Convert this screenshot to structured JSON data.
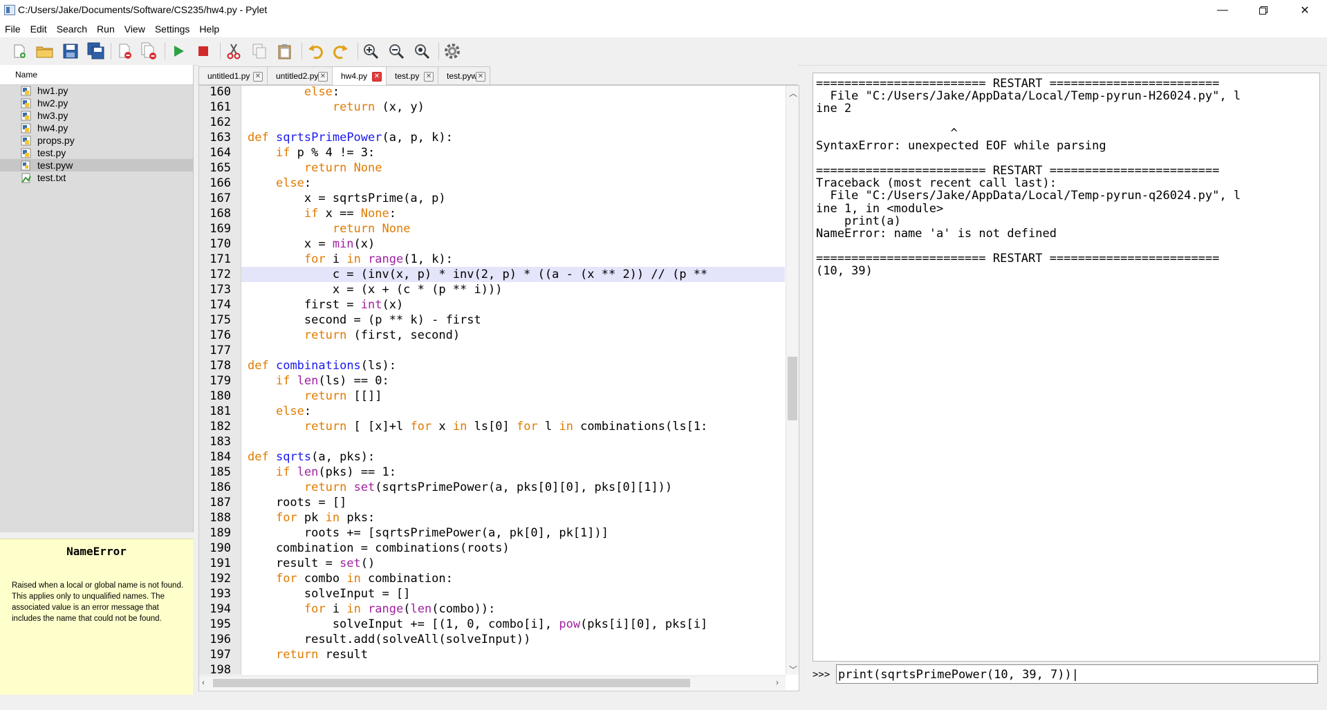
{
  "window": {
    "title": "C:/Users/Jake/Documents/Software/CS235/hw4.py - Pylet"
  },
  "menu": [
    "File",
    "Edit",
    "Search",
    "Run",
    "View",
    "Settings",
    "Help"
  ],
  "toolbar": {
    "icons": [
      "new-file-icon",
      "open-folder-icon",
      "save-icon",
      "save-all-icon",
      "close-file-icon",
      "close-all-icon",
      "run-icon",
      "stop-icon",
      "cut-icon",
      "copy-icon",
      "paste-icon",
      "undo-icon",
      "redo-icon",
      "zoom-in-icon",
      "zoom-out-icon",
      "zoom-reset-icon",
      "settings-gear-icon"
    ]
  },
  "sidebar": {
    "header": "Name",
    "files": [
      {
        "name": "hw1.py",
        "icon": "python-file-icon"
      },
      {
        "name": "hw2.py",
        "icon": "python-file-icon"
      },
      {
        "name": "hw3.py",
        "icon": "python-file-icon"
      },
      {
        "name": "hw4.py",
        "icon": "python-file-icon"
      },
      {
        "name": "props.py",
        "icon": "python-file-icon"
      },
      {
        "name": "test.py",
        "icon": "python-file-icon"
      },
      {
        "name": "test.pyw",
        "icon": "python-windowed-file-icon",
        "selected": true
      },
      {
        "name": "test.txt",
        "icon": "text-file-icon"
      }
    ]
  },
  "doc": {
    "title": "NameError",
    "body": "Raised when a local or global name is not found. This applies only to unqualified names. The associated value is an error message that includes the name that could not be found."
  },
  "tabs": [
    {
      "label": "untitled1.py",
      "active": false
    },
    {
      "label": "untitled2.py",
      "active": false
    },
    {
      "label": "hw4.py",
      "active": true
    },
    {
      "label": "test.py",
      "active": false
    },
    {
      "label": "test.pyw",
      "active": false
    }
  ],
  "editor": {
    "highlight_line": 172,
    "lines": [
      {
        "n": "160",
        "html": "        <span class=\"kw\">else</span>:"
      },
      {
        "n": "161",
        "html": "            <span class=\"kw\">return</span> (x, y)"
      },
      {
        "n": "162",
        "html": ""
      },
      {
        "n": "163",
        "html": "<span class=\"kw\">def</span> <span class=\"fn\">sqrtsPrimePower</span>(a, p, k):"
      },
      {
        "n": "164",
        "html": "    <span class=\"kw\">if</span> p % 4 != 3:"
      },
      {
        "n": "165",
        "html": "        <span class=\"kw\">return</span> <span class=\"kw\">None</span>"
      },
      {
        "n": "166",
        "html": "    <span class=\"kw\">else</span>:"
      },
      {
        "n": "167",
        "html": "        x = sqrtsPrime(a, p)"
      },
      {
        "n": "168",
        "html": "        <span class=\"kw\">if</span> x == <span class=\"kw\">None</span>:"
      },
      {
        "n": "169",
        "html": "            <span class=\"kw\">return</span> <span class=\"kw\">None</span>"
      },
      {
        "n": "170",
        "html": "        x = <span class=\"bi\">min</span>(x)"
      },
      {
        "n": "171",
        "html": "        <span class=\"kw\">for</span> i <span class=\"kw\">in</span> <span class=\"bi\">range</span>(1, k):"
      },
      {
        "n": "172",
        "html": "            c = (inv(x, p) * inv(2, p) * ((a - (x ** 2)) // (p **"
      },
      {
        "n": "173",
        "html": "            x = (x + (c * (p ** i)))"
      },
      {
        "n": "174",
        "html": "        first = <span class=\"bi\">int</span>(x)"
      },
      {
        "n": "175",
        "html": "        second = (p ** k) - first"
      },
      {
        "n": "176",
        "html": "        <span class=\"kw\">return</span> (first, second)"
      },
      {
        "n": "177",
        "html": ""
      },
      {
        "n": "178",
        "html": "<span class=\"kw\">def</span> <span class=\"fn\">combinations</span>(ls):"
      },
      {
        "n": "179",
        "html": "    <span class=\"kw\">if</span> <span class=\"bi\">len</span>(ls) == 0:"
      },
      {
        "n": "180",
        "html": "        <span class=\"kw\">return</span> [[]]"
      },
      {
        "n": "181",
        "html": "    <span class=\"kw\">else</span>:"
      },
      {
        "n": "182",
        "html": "        <span class=\"kw\">return</span> [ [x]+l <span class=\"kw\">for</span> x <span class=\"kw\">in</span> ls[0] <span class=\"kw\">for</span> l <span class=\"kw\">in</span> combinations(ls[1:"
      },
      {
        "n": "183",
        "html": ""
      },
      {
        "n": "184",
        "html": "<span class=\"kw\">def</span> <span class=\"fn\">sqrts</span>(a, pks):"
      },
      {
        "n": "185",
        "html": "    <span class=\"kw\">if</span> <span class=\"bi\">len</span>(pks) == 1:"
      },
      {
        "n": "186",
        "html": "        <span class=\"kw\">return</span> <span class=\"bi\">set</span>(sqrtsPrimePower(a, pks[0][0], pks[0][1]))"
      },
      {
        "n": "187",
        "html": "    roots = []"
      },
      {
        "n": "188",
        "html": "    <span class=\"kw\">for</span> pk <span class=\"kw\">in</span> pks:"
      },
      {
        "n": "189",
        "html": "        roots += [sqrtsPrimePower(a, pk[0], pk[1])]"
      },
      {
        "n": "190",
        "html": "    combination = combinations(roots)"
      },
      {
        "n": "191",
        "html": "    result = <span class=\"bi\">set</span>()"
      },
      {
        "n": "192",
        "html": "    <span class=\"kw\">for</span> combo <span class=\"kw\">in</span> combination:"
      },
      {
        "n": "193",
        "html": "        solveInput = []"
      },
      {
        "n": "194",
        "html": "        <span class=\"kw\">for</span> i <span class=\"kw\">in</span> <span class=\"bi\">range</span>(<span class=\"bi\">len</span>(combo)):"
      },
      {
        "n": "195",
        "html": "            solveInput += [(1, 0, combo[i], <span class=\"bi\">pow</span>(pks[i][0], pks[i]"
      },
      {
        "n": "196",
        "html": "        result.add(solveAll(solveInput))"
      },
      {
        "n": "197",
        "html": "    <span class=\"kw\">return</span> result"
      },
      {
        "n": "198",
        "html": ""
      }
    ]
  },
  "shell": {
    "lines": [
      "======================== RESTART ========================",
      "  File \"C:/Users/Jake/AppData/Local/Temp-pyrun-H26024.py\", l",
      "ine 2",
      "",
      "                   ^",
      "SyntaxError: unexpected EOF while parsing",
      "",
      "======================== RESTART ========================",
      "Traceback (most recent call last):",
      "  File \"C:/Users/Jake/AppData/Local/Temp-pyrun-q26024.py\", l",
      "ine 1, in <module>",
      "    print(a)",
      "NameError: name 'a' is not defined",
      "",
      "======================== RESTART ========================",
      "(10, 39)"
    ],
    "prompt": ">>>",
    "input_value": "print(sqrtsPrimePower(10, 39, 7))|"
  },
  "colors": {
    "keyword": "#e07b00",
    "function": "#1a1aee",
    "builtin": "#a020a0",
    "highlight": "#e4e4fa",
    "doc_bg": "#ffffcc"
  }
}
